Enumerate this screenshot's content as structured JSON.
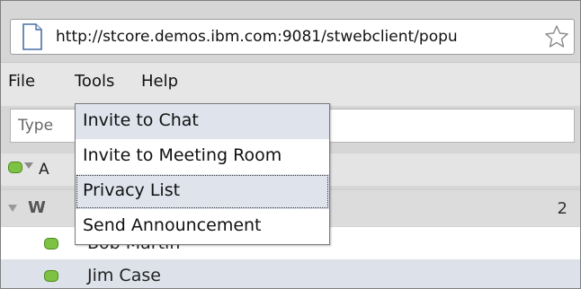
{
  "browser": {
    "url": "http://stcore.demos.ibm.com:9081/stwebclient/popu"
  },
  "menubar": {
    "items": [
      "File",
      "Tools",
      "Help"
    ]
  },
  "search": {
    "placeholder": "Type"
  },
  "status": {
    "partial_text": "A",
    "color": "#7dc242"
  },
  "group": {
    "partial_name": "W",
    "count": "2"
  },
  "contacts": [
    {
      "name": "Bob Martin"
    },
    {
      "name": "Jim Case"
    }
  ],
  "tools_menu": {
    "items": [
      "Invite to Chat",
      "Invite to Meeting Room",
      "Privacy List",
      "Send Announcement"
    ],
    "focused_item": "Privacy List"
  }
}
